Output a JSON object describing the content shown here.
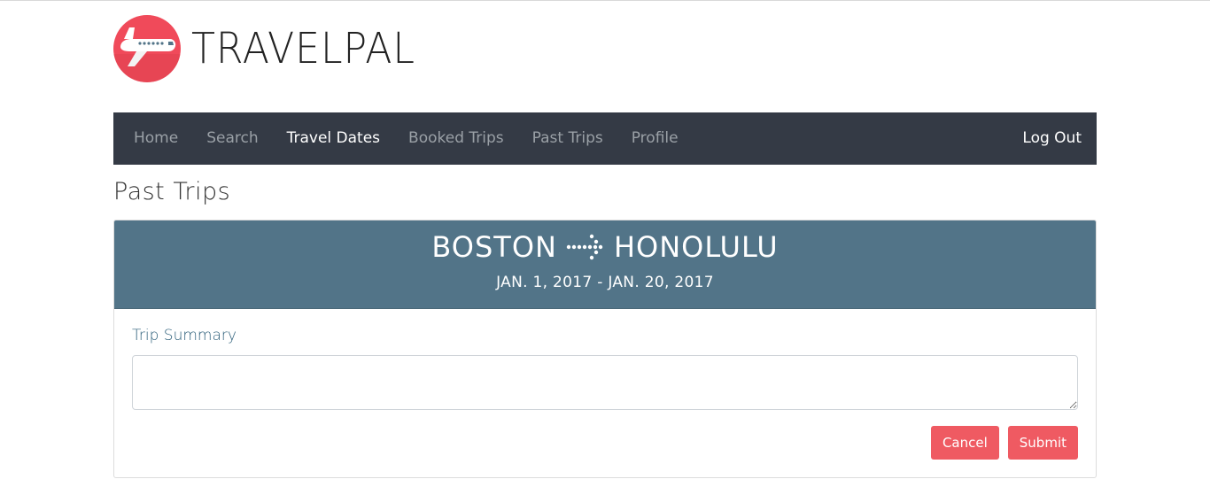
{
  "brand": {
    "name": "TRAVELPAL",
    "logo_icon": "airplane-icon",
    "logo_color": "#f04a5a"
  },
  "nav": {
    "items": [
      {
        "label": "Home",
        "active": false
      },
      {
        "label": "Search",
        "active": false
      },
      {
        "label": "Travel Dates",
        "active": true
      },
      {
        "label": "Booked Trips",
        "active": false
      },
      {
        "label": "Past Trips",
        "active": false
      },
      {
        "label": "Profile",
        "active": false
      }
    ],
    "logout": "Log Out",
    "background": "#343a45"
  },
  "page": {
    "title": "Past Trips"
  },
  "trip": {
    "origin": "BOSTON",
    "destination": "HONOLULU",
    "route_icon": "dotted-arrow-right-icon",
    "dates": "JAN. 1, 2017 - JAN. 20, 2017",
    "header_color": "#527488"
  },
  "form": {
    "summary_label": "Trip Summary",
    "summary_value": "",
    "cancel_label": "Cancel",
    "submit_label": "Submit",
    "button_color": "#ef5a62"
  }
}
